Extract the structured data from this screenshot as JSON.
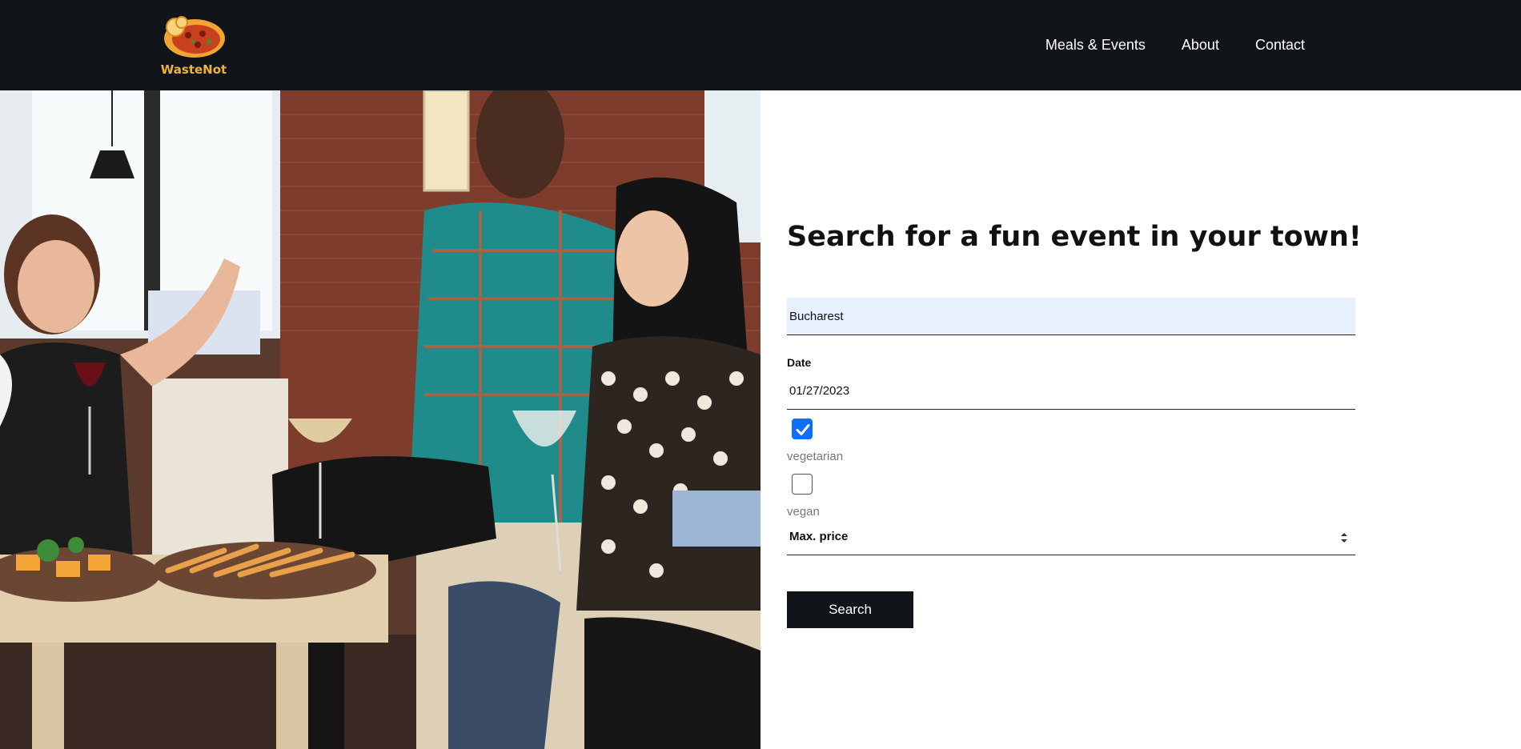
{
  "brand": {
    "name": "WasteNot",
    "logo_icon": "pizza-logo-icon"
  },
  "nav": {
    "items": [
      {
        "label": "Meals & Events"
      },
      {
        "label": "About"
      },
      {
        "label": "Contact"
      }
    ]
  },
  "search": {
    "title": "Search for a fun event in your town!",
    "location_value": "Bucharest",
    "date_label": "Date",
    "date_value": "01/27/2023",
    "options": [
      {
        "label": "vegetarian",
        "checked": true
      },
      {
        "label": "vegan",
        "checked": false
      }
    ],
    "max_price_placeholder": "Max. price",
    "button_label": "Search"
  },
  "colors": {
    "navbar": "#111418",
    "checkbox_accent": "#0d6efd",
    "autofill_bg": "#e8f0fe",
    "logo_text": "#f0b43c"
  }
}
